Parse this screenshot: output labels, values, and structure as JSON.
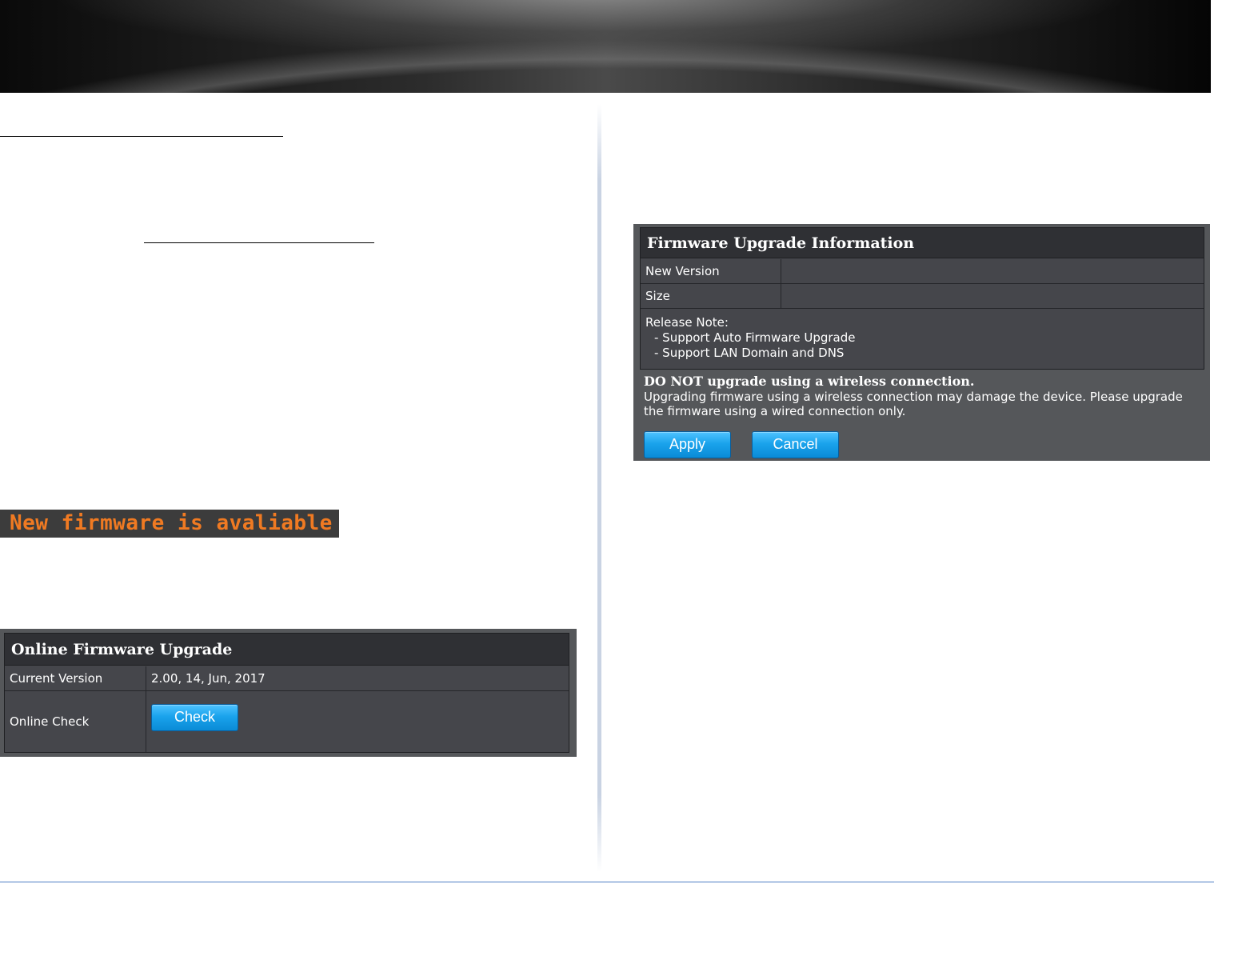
{
  "notice": {
    "text": "New firmware is avaliable"
  },
  "online_upgrade": {
    "title": "Online Firmware Upgrade",
    "rows": [
      {
        "label": "Current Version",
        "value": "2.00, 14, Jun, 2017"
      },
      {
        "label": "Online Check"
      }
    ],
    "check_button": "Check"
  },
  "upgrade_info": {
    "title": "Firmware Upgrade Information",
    "new_version_label": "New Version",
    "new_version_value": "",
    "size_label": "Size",
    "size_value": "",
    "release_note_label": "Release Note:",
    "release_notes": [
      "- Support Auto Firmware Upgrade",
      "- Support LAN Domain and DNS"
    ],
    "warning_title": "DO NOT upgrade using a wireless connection.",
    "warning_text": "Upgrading firmware using a wireless connection may damage the device. Please upgrade the firmware using a wired connection only.",
    "apply_button": "Apply",
    "cancel_button": "Cancel"
  },
  "colors": {
    "panel_bg": "#45464b",
    "panel_title_bg": "#2f3034",
    "notice_text": "#f07a22",
    "button_blue": "#1aa3ec",
    "footer_rule": "#4f7ec4"
  }
}
